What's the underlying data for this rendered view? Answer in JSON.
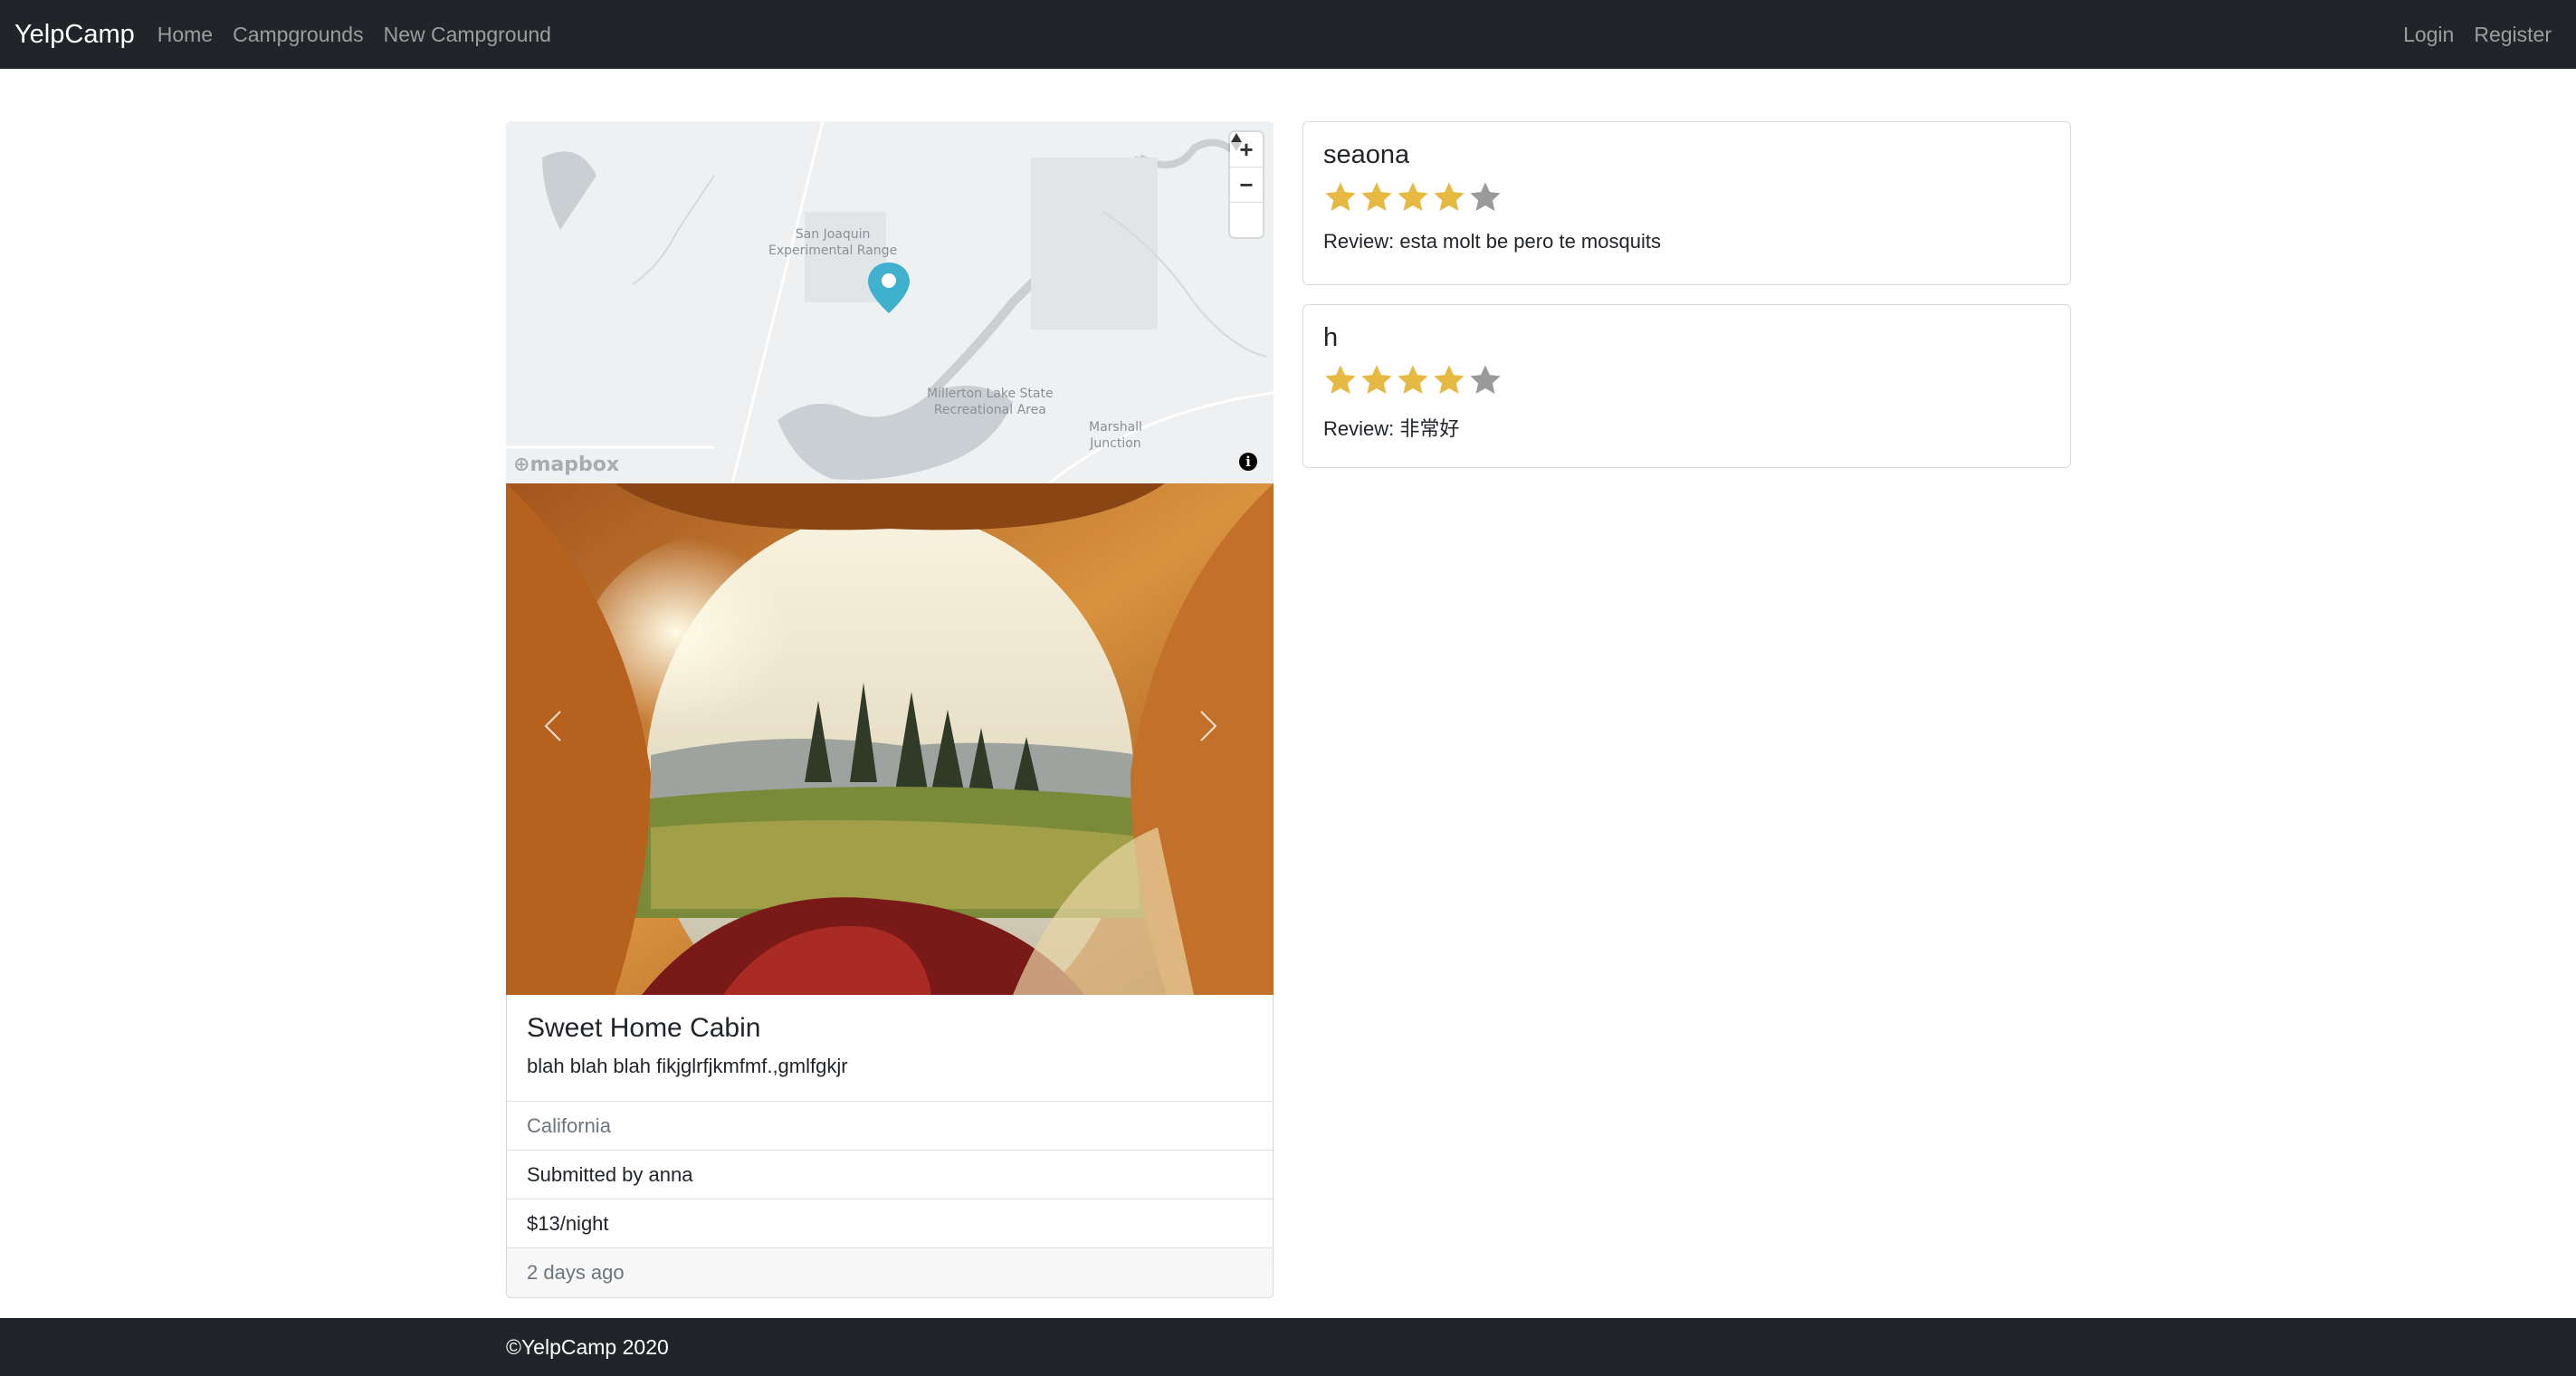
{
  "navbar": {
    "brand": "YelpCamp",
    "links": [
      "Home",
      "Campgrounds",
      "New Campground"
    ],
    "right_links": [
      "Login",
      "Register"
    ]
  },
  "map": {
    "labels": [
      "San Joaquin",
      "Experimental Range",
      "Millerton Lake State",
      "Recreational Area",
      "Marshall",
      "Junction"
    ],
    "zoom_in_icon": "plus-icon",
    "zoom_out_icon": "minus-icon",
    "compass_icon": "compass-icon",
    "logo_text": "mapbox",
    "info_icon": "i",
    "marker_color": "#3fb1ce"
  },
  "carousel": {
    "prev_icon": "chevron-left-icon",
    "next_icon": "chevron-right-icon"
  },
  "campground": {
    "title": "Sweet Home Cabin",
    "description": "blah blah blah fikjglrfjkmfmf.,gmlfgkjr",
    "location": "California",
    "submitted_by": "Submitted by anna",
    "price": "$13/night",
    "time_ago": "2 days ago"
  },
  "reviews": [
    {
      "author": "seaona",
      "rating": 4,
      "max_rating": 5,
      "text": "Review: esta molt be pero te mosquits"
    },
    {
      "author": "h",
      "rating": 4,
      "max_rating": 5,
      "text": "Review: 非常好"
    }
  ],
  "footer": {
    "text": "©YelpCamp 2020"
  },
  "colors": {
    "navbar_bg": "#212529",
    "star_filled": "#e6b943",
    "star_empty": "#9a9a9a"
  }
}
